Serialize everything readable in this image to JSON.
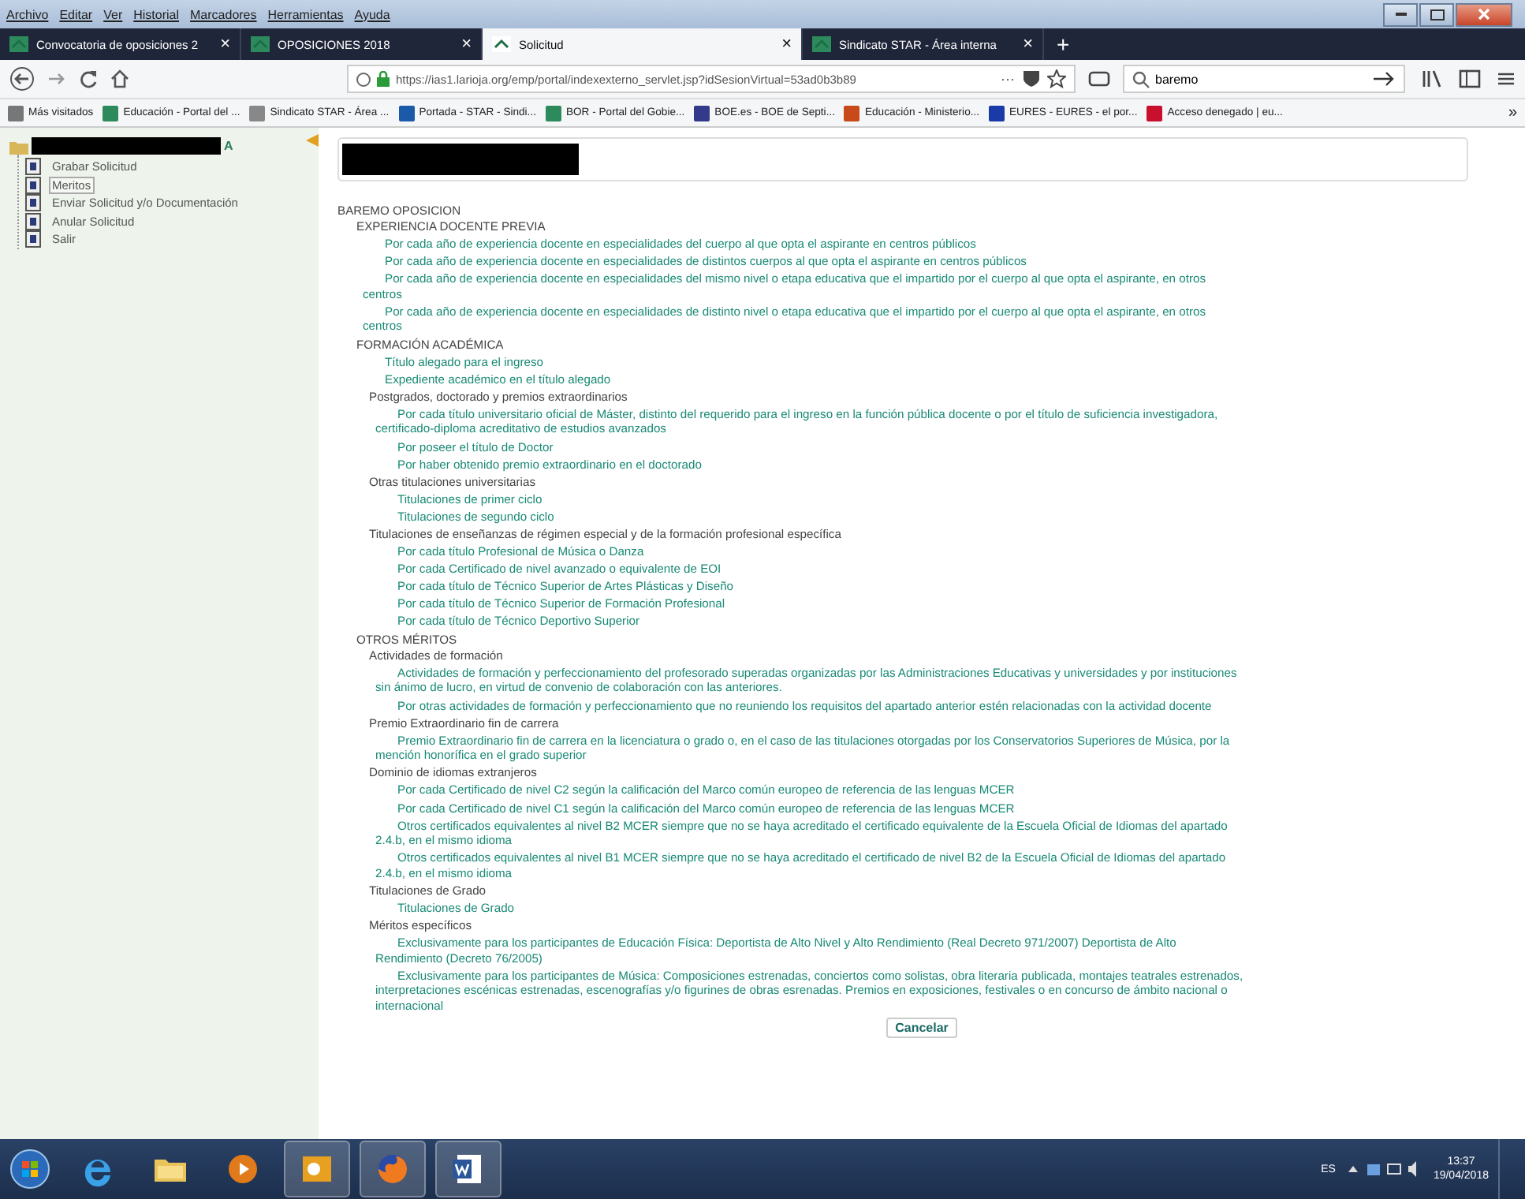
{
  "menu_bar": [
    "Archivo",
    "Editar",
    "Ver",
    "Historial",
    "Marcadores",
    "Herramientas",
    "Ayuda"
  ],
  "tabs": [
    {
      "label": "Convocatoria de oposiciones 2",
      "selected": false,
      "close": "×"
    },
    {
      "label": "OPOSICIONES 2018",
      "selected": false,
      "close": "×"
    },
    {
      "label": "Solicitud",
      "selected": true,
      "close": "×"
    },
    {
      "label": "Sindicato STAR - Área interna",
      "selected": false,
      "close": "×"
    }
  ],
  "new_tab": "+",
  "url": "https://ias1.larioja.org/emp/portal/indexexterno_servlet.jsp?idSesionVirtual=53ad0b3b89",
  "url_menu": "···",
  "search": {
    "value": "baremo"
  },
  "bookmarks": [
    "Más visitados",
    "Educación - Portal del ...",
    "Sindicato STAR - Área ...",
    "Portada - STAR - Sindi...",
    "BOR - Portal del Gobie...",
    "BOE.es - BOE de Septi...",
    "Educación - Ministerio...",
    "EURES - EURES - el por...",
    "Acceso denegado | eu..."
  ],
  "bookmarks_more": "»",
  "sidebar": {
    "title_tail": "A",
    "items": [
      {
        "label": "Grabar Solicitud",
        "selected": false
      },
      {
        "label": "Meritos",
        "selected": true
      },
      {
        "label": "Enviar Solicitud y/o Documentación",
        "selected": false
      },
      {
        "label": "Anular Solicitud",
        "selected": false
      },
      {
        "label": "Salir",
        "selected": false
      }
    ]
  },
  "tree": {
    "label": "BAREMO OPOSICION",
    "children": [
      {
        "label": "EXPERIENCIA DOCENTE PREVIA",
        "children": [
          {
            "label": "Por cada año de experiencia docente en especialidades del cuerpo al que opta el aspirante en centros públicos"
          },
          {
            "label": "Por cada año de experiencia docente en especialidades de distintos cuerpos al que opta el aspirante en centros públicos"
          },
          {
            "label": "Por cada año de experiencia docente en especialidades del mismo nivel o etapa educativa que el impartido por el cuerpo al que opta el aspirante, en otros centros"
          },
          {
            "label": "Por cada año de experiencia docente en especialidades de distinto nivel o etapa educativa que el impartido por el cuerpo al que opta el aspirante, en otros centros"
          }
        ]
      },
      {
        "label": "FORMACIÓN ACADÉMICA",
        "children": [
          {
            "label": "Título alegado para el ingreso"
          },
          {
            "label": "Expediente académico en el título alegado"
          },
          {
            "label": "Postgrados, doctorado y premios extraordinarios",
            "children": [
              {
                "label": "Por cada título universitario oficial de Máster, distinto del requerido para el ingreso en la función pública docente o por el título de suficiencia investigadora, certificado-diploma acreditativo de estudios avanzados"
              },
              {
                "label": "Por poseer el título de Doctor"
              },
              {
                "label": "Por haber obtenido premio extraordinario en el doctorado"
              }
            ]
          },
          {
            "label": "Otras titulaciones universitarias",
            "children": [
              {
                "label": "Titulaciones de primer ciclo"
              },
              {
                "label": "Titulaciones de segundo ciclo"
              }
            ]
          },
          {
            "label": "Titulaciones de enseñanzas de régimen especial y de la formación profesional específica",
            "children": [
              {
                "label": "Por cada título Profesional de Música o Danza"
              },
              {
                "label": "Por cada Certificado de nivel avanzado o equivalente de EOI"
              },
              {
                "label": "Por cada título de Técnico Superior de Artes Plásticas y Diseño"
              },
              {
                "label": "Por cada título de Técnico Superior de Formación Profesional"
              },
              {
                "label": "Por cada título de Técnico Deportivo Superior"
              }
            ]
          }
        ]
      },
      {
        "label": "OTROS MÉRITOS",
        "children": [
          {
            "label": "Actividades de formación",
            "children": [
              {
                "label": "Actividades de formación y perfeccionamiento del profesorado superadas organizadas por las Administraciones Educativas y universidades y por instituciones sin ánimo de lucro, en virtud de convenio de colaboración con las anteriores."
              },
              {
                "label": "Por otras actividades de formación y perfeccionamiento que no reuniendo los requisitos del apartado anterior estén relacionadas con la actividad docente"
              }
            ]
          },
          {
            "label": "Premio Extraordinario fin de carrera",
            "children": [
              {
                "label": "Premio Extraordinario fin de carrera en la licenciatura o grado o, en el caso de las titulaciones otorgadas por los Conservatorios Superiores de Música, por la mención honorífica en el grado superior"
              }
            ]
          },
          {
            "label": "Dominio de idiomas extranjeros",
            "children": [
              {
                "label": "Por cada Certificado de nivel C2 según la calificación del Marco común europeo de referencia de las lenguas MCER"
              },
              {
                "label": "Por cada Certificado de nivel C1 según la calificación del Marco común europeo de referencia de las lenguas MCER"
              },
              {
                "label": "Otros certificados equivalentes al nivel B2 MCER siempre que no se haya acreditado el certificado equivalente de la Escuela Oficial de Idiomas del apartado 2.4.b, en el mismo idioma"
              },
              {
                "label": "Otros certificados equivalentes al nivel B1 MCER siempre que no se haya acreditado el certificado de nivel B2 de la Escuela Oficial de Idiomas del apartado 2.4.b, en el mismo idioma"
              }
            ]
          },
          {
            "label": "Titulaciones de Grado",
            "children": [
              {
                "label": "Titulaciones de Grado"
              }
            ]
          },
          {
            "label": "Méritos específicos",
            "children": [
              {
                "label": "Exclusivamente para los participantes de Educación Física: Deportista de Alto Nivel y Alto Rendimiento (Real Decreto 971/2007) Deportista de Alto Rendimiento (Decreto 76/2005)"
              },
              {
                "label": "Exclusivamente para los participantes de Música: Composiciones estrenadas, conciertos como solistas, obra literaria publicada, montajes teatrales estrenados, interpretaciones escénicas estrenadas, escenografías y/o figurines de obras esrenadas. Premios en exposiciones, festivales o en concurso de ámbito nacional o internacional"
              }
            ]
          }
        ]
      }
    ]
  },
  "cancel_button": "Cancelar",
  "taskbar": {
    "language": "ES",
    "time": "13:37",
    "date": "19/04/2018"
  }
}
